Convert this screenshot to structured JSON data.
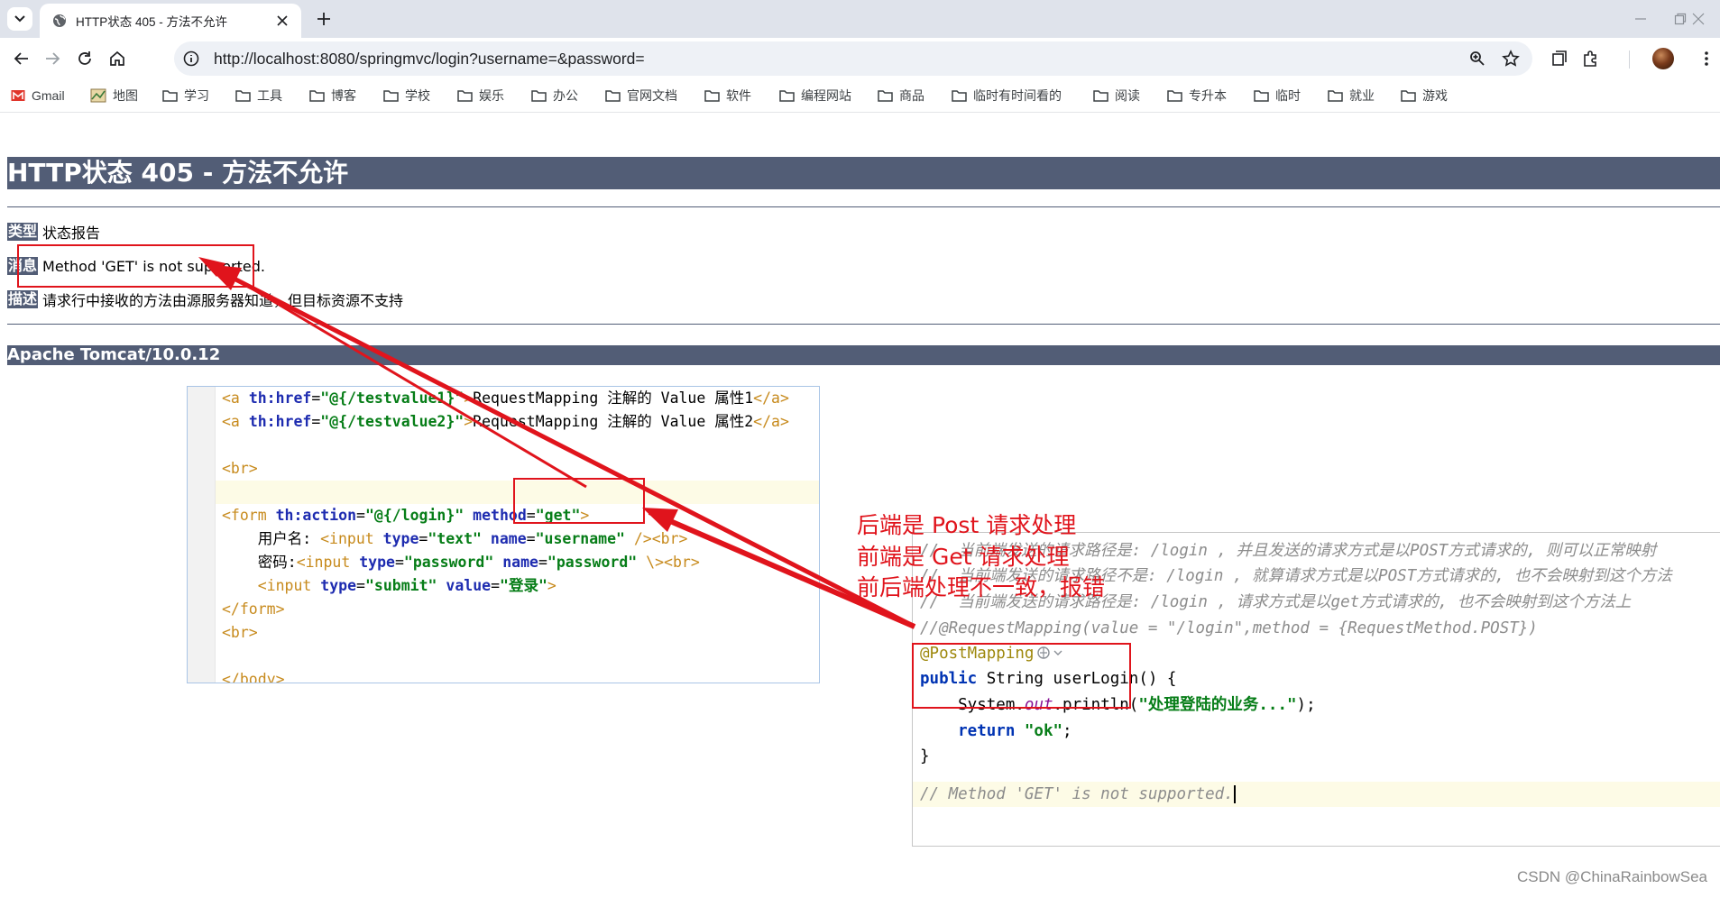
{
  "browser": {
    "tab_title": "HTTP状态 405 - 方法不允许",
    "url": "http://localhost:8080/springmvc/login?username=&password=",
    "bookmarks": [
      "Gmail",
      "地图",
      "学习",
      "工具",
      "博客",
      "学校",
      "娱乐",
      "办公",
      "官网文档",
      "软件",
      "编程网站",
      "商品",
      "临时有时间看的",
      "阅读",
      "专升本",
      "临时",
      "就业",
      "游戏"
    ]
  },
  "page": {
    "heading": "HTTP状态 405 - 方法不允许",
    "type_label": "类型",
    "type_value": "状态报告",
    "message_label": "消息",
    "message_value": "Method 'GET' is not supported.",
    "desc_label": "描述",
    "desc_value": "请求行中接收的方法由源服务器知道，但目标资源不支持",
    "server": "Apache Tomcat/10.0.12"
  },
  "code_left": {
    "line1": {
      "open": "<a ",
      "attr": "th:href",
      "eq": "=",
      "val": "\"@{/testvalue1}\"",
      "gt": ">",
      "text": "RequestMapping 注解的 Value 属性1",
      "close": "</a>"
    },
    "line2": {
      "open": "<a ",
      "attr": "th:href",
      "eq": "=",
      "val": "\"@{/testvalue2}\"",
      "gt": ">",
      "text": "RequestMapping 注解的 Value 属性2",
      "close": "</a>"
    },
    "br": "<br>",
    "form_open": "<form ",
    "form_attr1": "th:action",
    "form_val1": "\"@{/login}\"",
    "form_attr2": "method",
    "form_val2": "\"get\"",
    "user_label": "用户名: ",
    "user_input": "<input ",
    "user_type": "type",
    "user_type_val": "\"text\"",
    "user_name": "name",
    "user_name_val": "\"username\"",
    "user_end": " /><br>",
    "pwd_label": "密码:",
    "pwd_input": "<input ",
    "pwd_type": "type",
    "pwd_type_val": "\"password\"",
    "pwd_name": "name",
    "pwd_name_val": "\"password\"",
    "pwd_end": " \\><br>",
    "submit_input": "<input ",
    "submit_type": "type",
    "submit_type_val": "\"submit\"",
    "submit_value": "value",
    "submit_value_val": "\"登录\"",
    "submit_end": ">",
    "form_close": "</form>",
    "body_close": "</body>"
  },
  "code_right": {
    "c1": "//  当前端发送的请求路径是: /login , 并且发送的请求方式是以POST方式请求的, 则可以正常映射",
    "c2": "//  当前端发送的请求路径不是: /login , 就算请求方式是以POST方式请求的, 也不会映射到这个方法",
    "c3": "//  当前端发送的请求路径是: /login , 请求方式是以get方式请求的, 也不会映射到这个方法上",
    "c4": "//@RequestMapping(value = \"/login\",method = {RequestMethod.POST})",
    "anno": "@PostMapping",
    "sig_kw": "public",
    "sig_rest": " String userLogin() {",
    "print_pre": "    System.",
    "print_field": "out",
    "print_mid": ".println(",
    "print_str": "\"处理登陆的业务...\"",
    "print_end": ");",
    "ret_kw": "    return",
    "ret_str": " \"ok\"",
    "ret_end": ";",
    "brace": "}",
    "last_comment": "// Method 'GET' is not supported."
  },
  "annotations": {
    "line1": "后端是  Post 请求处理",
    "line2": "前端是  Get 请求处理",
    "line3": "前后端处理不一致，报错"
  },
  "watermark": "CSDN @ChinaRainbowSea",
  "colors": {
    "tomcat_bar": "#525d76",
    "annotation_red": "#e0141c"
  }
}
